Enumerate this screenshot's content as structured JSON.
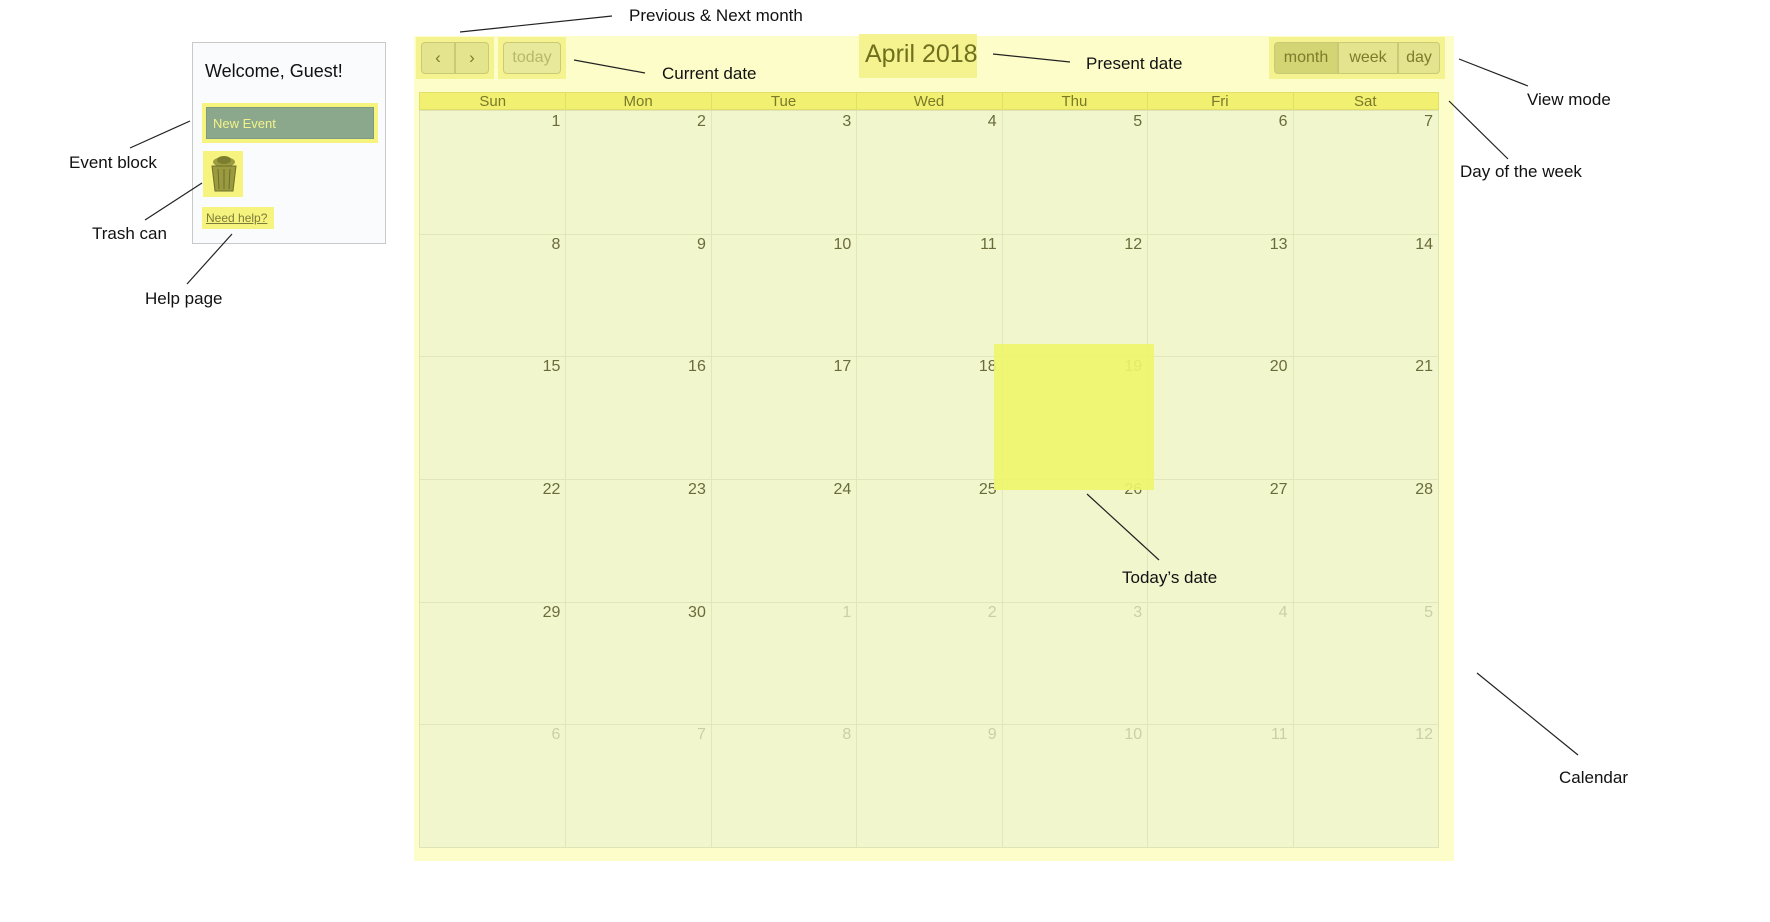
{
  "sidebar": {
    "welcome": "Welcome, Guest!",
    "new_event": "New Event",
    "trash_icon": "trash-can-icon",
    "help_link": "Need help?"
  },
  "toolbar": {
    "prev_label": "‹",
    "next_label": "›",
    "today_label": "today",
    "title": "April 2018",
    "view_modes": [
      "month",
      "week",
      "day"
    ]
  },
  "calendar": {
    "days_of_week": [
      "Sun",
      "Mon",
      "Tue",
      "Wed",
      "Thu",
      "Fri",
      "Sat"
    ],
    "weeks": [
      [
        {
          "n": "1"
        },
        {
          "n": "2"
        },
        {
          "n": "3"
        },
        {
          "n": "4"
        },
        {
          "n": "5"
        },
        {
          "n": "6"
        },
        {
          "n": "7"
        }
      ],
      [
        {
          "n": "8"
        },
        {
          "n": "9"
        },
        {
          "n": "10"
        },
        {
          "n": "11"
        },
        {
          "n": "12"
        },
        {
          "n": "13"
        },
        {
          "n": "14"
        }
      ],
      [
        {
          "n": "15"
        },
        {
          "n": "16"
        },
        {
          "n": "17"
        },
        {
          "n": "18"
        },
        {
          "n": "19"
        },
        {
          "n": "20"
        },
        {
          "n": "21"
        }
      ],
      [
        {
          "n": "22"
        },
        {
          "n": "23"
        },
        {
          "n": "24"
        },
        {
          "n": "25"
        },
        {
          "n": "26"
        },
        {
          "n": "27"
        },
        {
          "n": "28"
        }
      ],
      [
        {
          "n": "29"
        },
        {
          "n": "30"
        },
        {
          "n": "1",
          "other": true
        },
        {
          "n": "2",
          "other": true
        },
        {
          "n": "3",
          "other": true
        },
        {
          "n": "4",
          "other": true
        },
        {
          "n": "5",
          "other": true
        }
      ],
      [
        {
          "n": "6",
          "other": true
        },
        {
          "n": "7",
          "other": true
        },
        {
          "n": "8",
          "other": true
        },
        {
          "n": "9",
          "other": true
        },
        {
          "n": "10",
          "other": true
        },
        {
          "n": "11",
          "other": true
        },
        {
          "n": "12",
          "other": true
        }
      ]
    ]
  },
  "annotations": {
    "prev_next": "Previous & Next month",
    "current_date": "Current date",
    "present_date": "Present date",
    "view_mode": "View mode",
    "day_of_week": "Day of the week",
    "event_block": "Event block",
    "trash_can": "Trash can",
    "help_page": "Help page",
    "todays_date": "Today’s date",
    "calendar": "Calendar"
  },
  "colors": {
    "highlight": "#f5f38f",
    "calendar_bg": "#f1f6cd",
    "today_cell": "#eef56b",
    "event_block": "#8ba88c"
  }
}
